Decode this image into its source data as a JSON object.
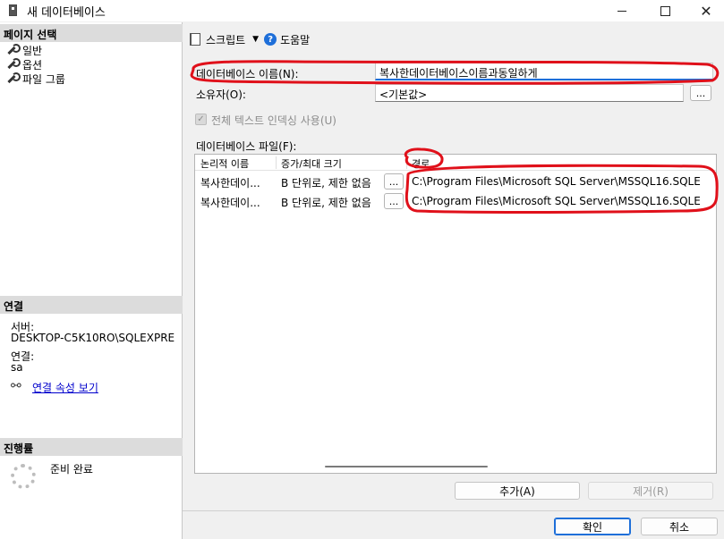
{
  "window": {
    "title": "새 데이터베이스",
    "close_glyph": "✕"
  },
  "left_pane": {
    "page_select_header": "페이지 선택",
    "pages": [
      {
        "label": "일반"
      },
      {
        "label": "옵션"
      },
      {
        "label": "파일 그룹"
      }
    ],
    "connection_header": "연결",
    "server_label": "서버:",
    "server_value": "DESKTOP-C5K10RO\\SQLEXPRE",
    "connection_label": "연결:",
    "connection_value": "sa",
    "view_connection_properties": "연결 속성 보기",
    "progress_header": "진행률",
    "progress_status": "준비 완료"
  },
  "toolbar": {
    "script_label": "스크립트",
    "help_label": "도움말"
  },
  "form": {
    "db_name_label": "데이터베이스 이름(N):",
    "db_name_value": "복사한데이터베이스이름과동일하게",
    "owner_label": "소유자(O):",
    "owner_value": "<기본값>",
    "browse_label": "...",
    "fulltext_label": "전체 텍스트 인덱싱 사용(U)",
    "fulltext_checked": true,
    "db_files_label": "데이터베이스 파일(F):"
  },
  "files_grid": {
    "columns": [
      "논리적 이름",
      "증가/최대 크기",
      "경로"
    ],
    "rows": [
      {
        "logical_name": "복사한데이...",
        "growth": "B 단위로, 제한 없음",
        "browse": "...",
        "path": "C:\\Program Files\\Microsoft SQL Server\\MSSQL16.SQLE"
      },
      {
        "logical_name": "복사한데이...",
        "growth": "B 단위로, 제한 없음",
        "browse": "...",
        "path": "C:\\Program Files\\Microsoft SQL Server\\MSSQL16.SQLE"
      }
    ]
  },
  "buttons": {
    "add": "추가(A)",
    "remove": "제거(R)",
    "ok": "확인",
    "cancel": "취소"
  },
  "colors": {
    "annotation": "#e0101a",
    "accent": "#1e6fd9"
  }
}
